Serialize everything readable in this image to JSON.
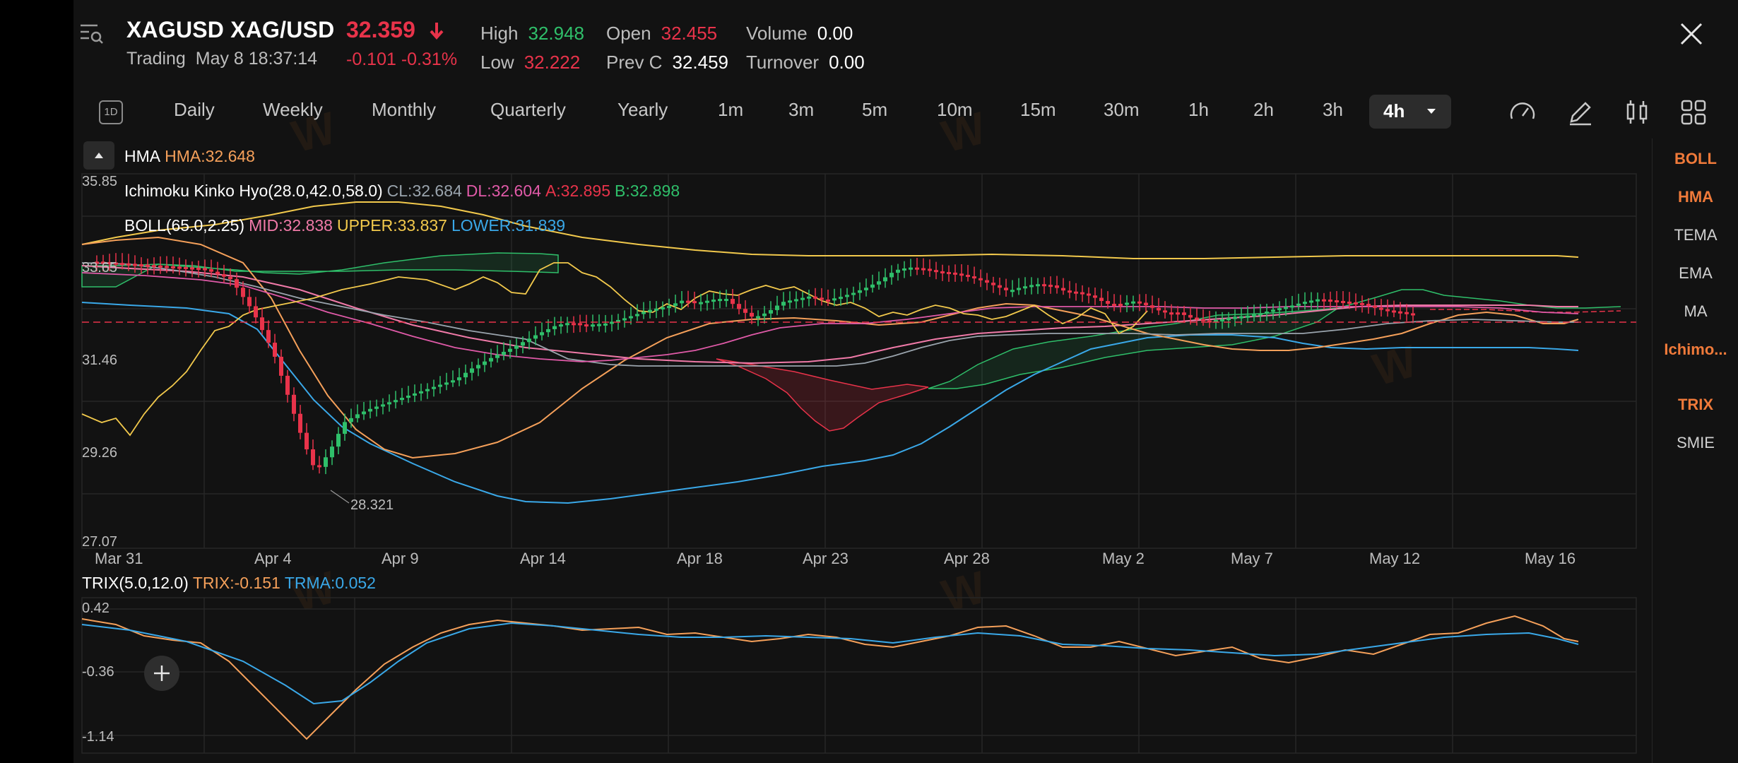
{
  "header": {
    "symbol": "XAGUSD XAG/USD",
    "price": "32.359",
    "status": "Trading",
    "datetime": "May 8 18:37:14",
    "change": "-0.101 -0.31%",
    "stats": [
      {
        "label": "High",
        "value": "32.948",
        "color": "#2fbf6a"
      },
      {
        "label": "Low",
        "value": "32.222",
        "color": "#e8334a"
      },
      {
        "label": "Open",
        "value": "32.455",
        "color": "#e8334a"
      },
      {
        "label": "Prev C",
        "value": "32.459",
        "color": "#ffffff"
      },
      {
        "label": "Volume",
        "value": "0.00",
        "color": "#ffffff"
      },
      {
        "label": "Turnover",
        "value": "0.00",
        "color": "#ffffff"
      }
    ]
  },
  "toolbar": {
    "day_badge": "1D",
    "timeframes": [
      "Daily",
      "Weekly",
      "Monthly",
      "Quarterly",
      "Yearly",
      "1m",
      "3m",
      "5m",
      "10m",
      "15m",
      "30m",
      "1h",
      "2h",
      "3h"
    ],
    "active": "4h"
  },
  "indicators": {
    "hma": {
      "name": "HMA",
      "value": "HMA:32.648"
    },
    "ichimoku": {
      "name": "Ichimoku Kinko Hyo(28.0,42.0,58.0)",
      "cl": "CL:32.684",
      "dl": "DL:32.604",
      "a": "A:32.895",
      "b": "B:32.898"
    },
    "boll": {
      "name": "BOLL(65.0,2.25)",
      "mid": "MID:32.838",
      "upper": "UPPER:33.837",
      "lower": "LOWER:31.839"
    },
    "trix": {
      "name": "TRIX(5.0,12.0)",
      "trix": "TRIX:-0.151",
      "trma": "TRMA:0.052"
    }
  },
  "main_y_labels": [
    "35.85",
    "33.65",
    "31.46",
    "29.26",
    "27.07"
  ],
  "low_marker": "28.321",
  "x_labels": [
    "Mar 31",
    "Apr 4",
    "Apr 9",
    "Apr 14",
    "Apr 18",
    "Apr 23",
    "Apr 28",
    "May 2",
    "May 7",
    "May 12",
    "May 16"
  ],
  "trix_y_labels": [
    "0.42",
    "-0.36",
    "-1.14"
  ],
  "side_panel": [
    {
      "label": "BOLL",
      "active": true
    },
    {
      "label": "HMA",
      "active": true
    },
    {
      "label": "TEMA",
      "active": false
    },
    {
      "label": "EMA",
      "active": false
    },
    {
      "label": "MA",
      "active": false
    },
    {
      "label": "Ichimo...",
      "active": true
    },
    {
      "label": "TRIX",
      "active": true
    },
    {
      "label": "SMIE",
      "active": false
    }
  ],
  "colors": {
    "up": "#2fbf6a",
    "down": "#e8334a",
    "hma": "#f5a05a",
    "boll_upper": "#f2c94c",
    "boll_mid": "#f07aa8",
    "boll_lower": "#3aa8e8",
    "ichimoku_cl": "#9aa4ad",
    "ichimoku_dl": "#e05aa8",
    "ichimoku_a": "#e8334a",
    "ichimoku_b": "#2fbf6a",
    "accent": "#f07a3a"
  }
}
